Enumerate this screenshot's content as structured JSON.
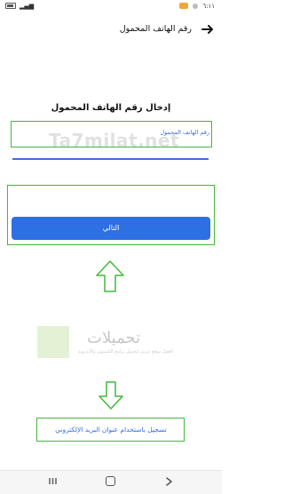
{
  "status_bar": {
    "time": "٦:١١",
    "icons": [
      "battery-icon",
      "signal-icon",
      "wifi-icon",
      "notification-icon"
    ]
  },
  "app_bar": {
    "title": "رقم الهاتف المحمول",
    "back_icon": "arrow-right-icon"
  },
  "form": {
    "heading": "إدخال رقم الهاتف المحمول",
    "phone_label": "رقم الهاتف المحمول",
    "phone_value": "",
    "next_button_label": "التالي"
  },
  "email_link_label": "تسجيل باستخدام عنوان البريد الإلكتروني",
  "watermark": {
    "text": "Ta7milat.net",
    "logo_name": "تحميلات",
    "logo_tagline": "أفضل موقع عربي لتحميل برامج الكمبيوتر والأندرويد"
  },
  "nav_bar": {
    "icons": [
      "recent-apps-icon",
      "home-icon",
      "back-nav-icon"
    ]
  },
  "colors": {
    "accent": "#2f6fe4",
    "annotation_green": "#41b83c"
  }
}
